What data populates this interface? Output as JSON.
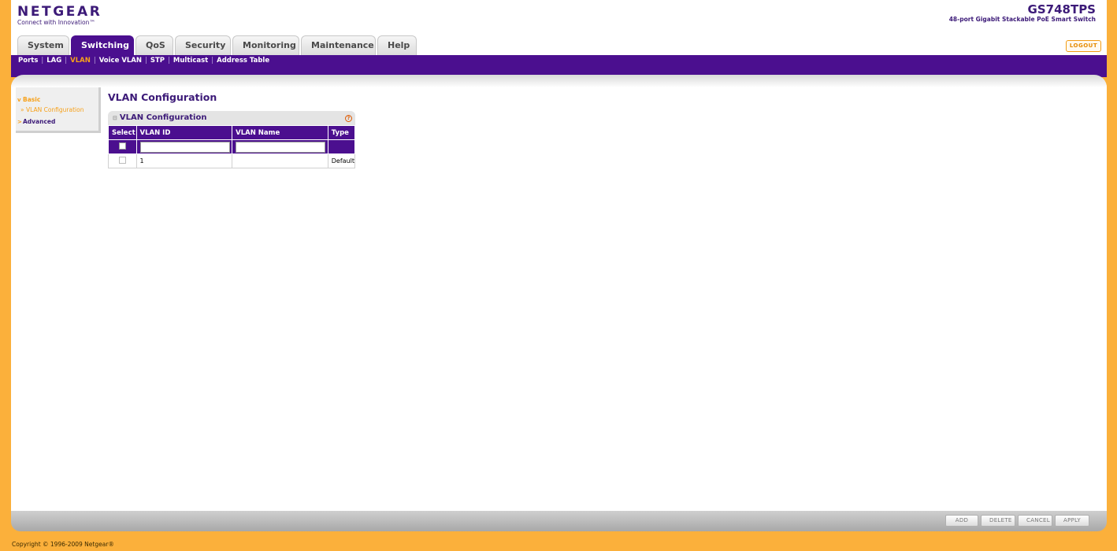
{
  "header": {
    "logo": "NETGEAR",
    "tagline": "Connect with Innovation™",
    "model": "GS748TPS",
    "model_desc": "48-port Gigabit Stackable PoE Smart Switch",
    "logout_label": "LOGOUT"
  },
  "tabs": [
    {
      "label": "System"
    },
    {
      "label": "Switching",
      "active": true
    },
    {
      "label": "QoS"
    },
    {
      "label": "Security"
    },
    {
      "label": "Monitoring"
    },
    {
      "label": "Maintenance"
    },
    {
      "label": "Help"
    }
  ],
  "subnav": [
    "Ports",
    "LAG",
    "VLAN",
    "Voice VLAN",
    "STP",
    "Multicast",
    "Address Table"
  ],
  "sidebar": {
    "basic": "Basic",
    "vlan_config": "» VLAN Configuration",
    "advanced": "Advanced"
  },
  "page_title": "VLAN Configuration",
  "panel": {
    "title": "VLAN Configuration",
    "help": "?",
    "columns": [
      "Select",
      "VLAN ID",
      "VLAN Name",
      "Type"
    ],
    "rows": [
      {
        "vlan_id": "1",
        "vlan_name": "",
        "type": "Default"
      }
    ],
    "inputs": {
      "vlan_id": "",
      "vlan_name": ""
    }
  },
  "buttons": {
    "add": "ADD",
    "delete": "DELETE",
    "cancel": "CANCEL",
    "apply": "APPLY"
  },
  "footer": {
    "copyright": "Copyright © 1996-2009 Netgear®"
  }
}
